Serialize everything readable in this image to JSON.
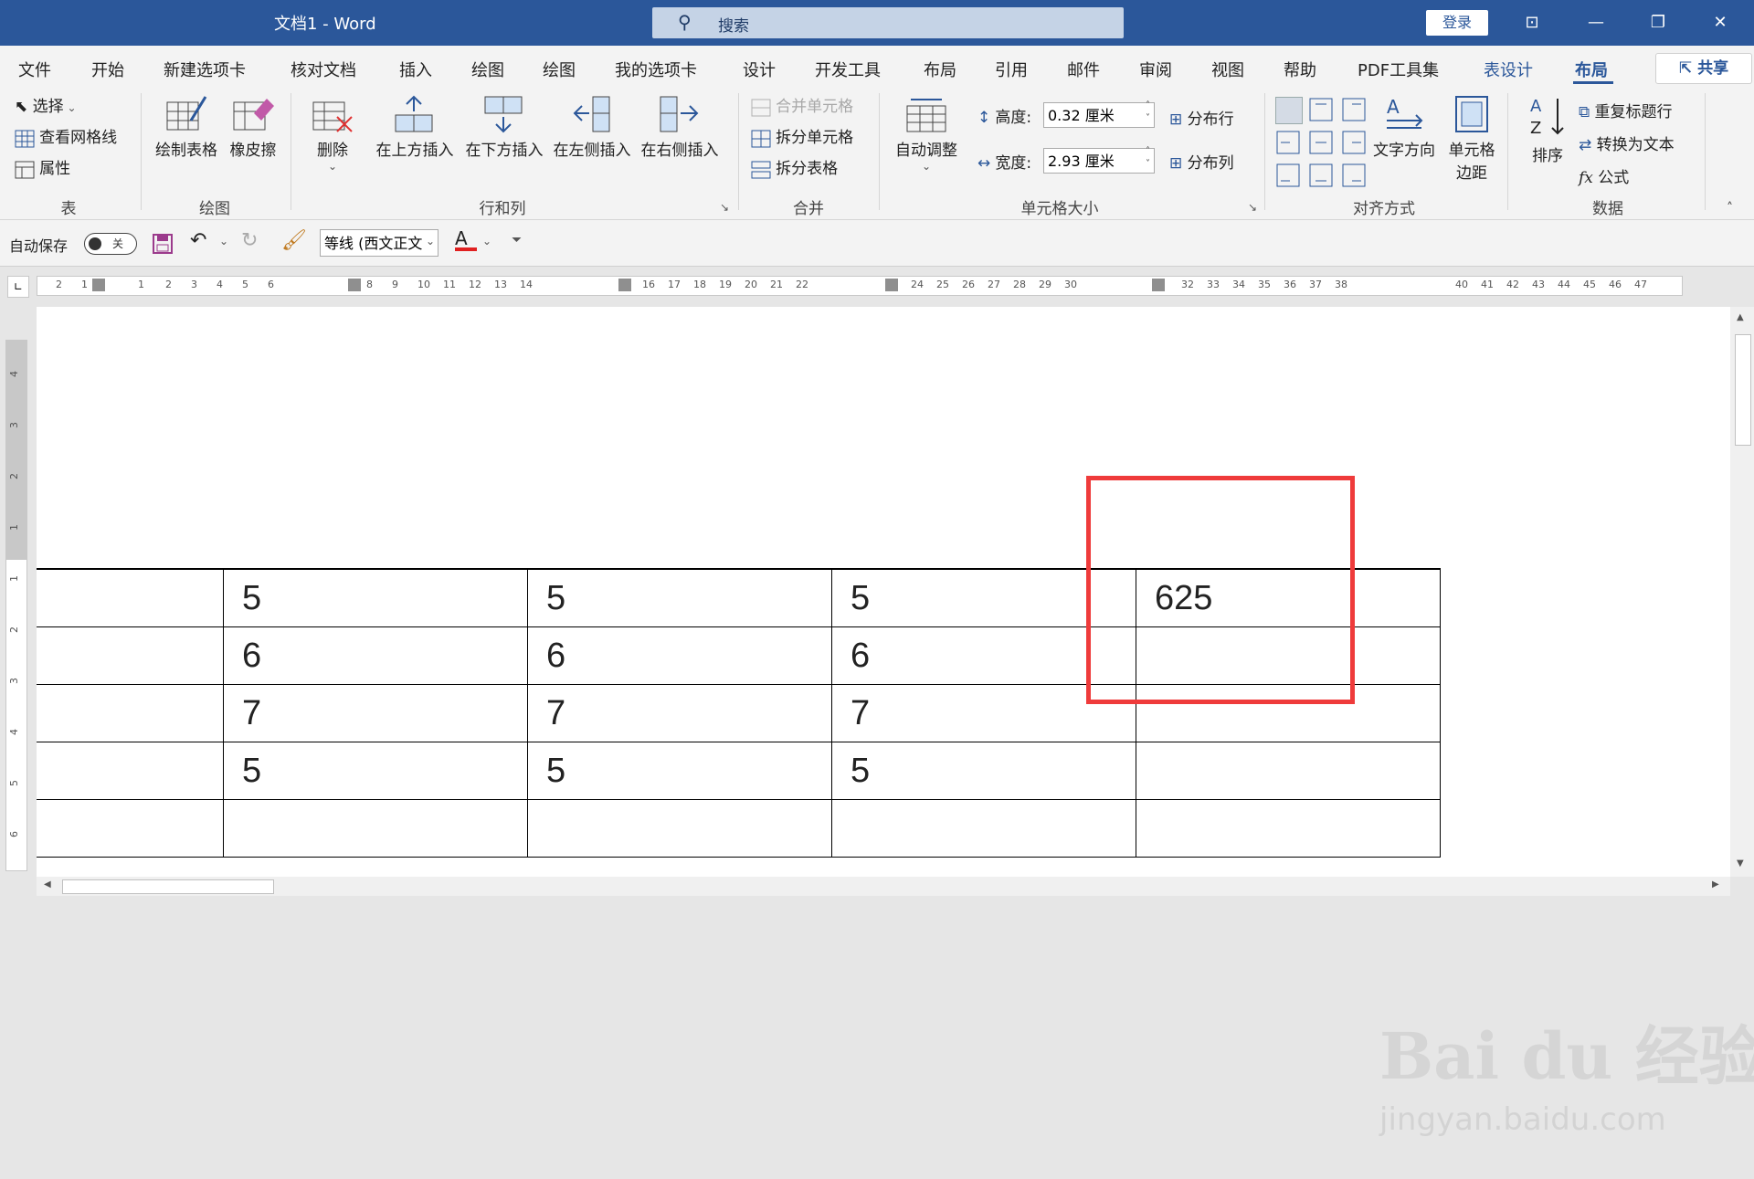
{
  "titlebar": {
    "doc_title": "文档1  -  Word",
    "search_label": "搜索",
    "login_label": "登录",
    "ribbon_display_icon": "ribbon-display-icon",
    "minimize_icon": "minimize-icon",
    "restore_icon": "restore-icon",
    "close_icon": "close-icon"
  },
  "tabs": [
    "文件",
    "开始",
    "新建选项卡",
    "核对文档",
    "插入",
    "绘图",
    "绘图",
    "我的选项卡",
    "设计",
    "开发工具",
    "布局",
    "引用",
    "邮件",
    "审阅",
    "视图",
    "帮助",
    "PDF工具集",
    "表设计",
    "布局"
  ],
  "share_label": "共享",
  "ribbon": {
    "table_group": {
      "label": "表",
      "select": "选择",
      "gridlines": "查看网格线",
      "properties": "属性"
    },
    "draw_group": {
      "label": "绘图",
      "draw_table": "绘制表格",
      "eraser": "橡皮擦"
    },
    "rowcol_group": {
      "label": "行和列",
      "delete": "删除",
      "insert_above": "在上方插入",
      "insert_below": "在下方插入",
      "insert_left": "在左侧插入",
      "insert_right": "在右侧插入"
    },
    "merge_group": {
      "label": "合并",
      "merge_cells": "合并单元格",
      "split_cells": "拆分单元格",
      "split_table": "拆分表格"
    },
    "cellsize_group": {
      "label": "单元格大小",
      "autofit": "自动调整",
      "height_label": "高度:",
      "height_value": "0.32 厘米",
      "width_label": "宽度:",
      "width_value": "2.93 厘米",
      "distribute_rows": "分布行",
      "distribute_cols": "分布列"
    },
    "align_group": {
      "label": "对齐方式",
      "text_direction": "文字方向",
      "cell_margins_1": "单元格",
      "cell_margins_2": "边距"
    },
    "data_group": {
      "label": "数据",
      "sort": "排序",
      "repeat_header": "重复标题行",
      "convert_text": "转换为文本",
      "formula": "公式"
    }
  },
  "qat": {
    "autosave_label": "自动保存",
    "toggle_label": "关",
    "font_name": "等线 (西文正文"
  },
  "ruler": {
    "h_numbers": [
      "2",
      "1",
      "1",
      "2",
      "3",
      "4",
      "5",
      "6",
      "8",
      "9",
      "10",
      "11",
      "12",
      "13",
      "14",
      "16",
      "17",
      "18",
      "19",
      "20",
      "21",
      "22",
      "24",
      "25",
      "26",
      "27",
      "28",
      "29",
      "30",
      "32",
      "33",
      "34",
      "35",
      "36",
      "37",
      "38",
      "40",
      "41",
      "42",
      "43",
      "44",
      "45",
      "46",
      "47"
    ],
    "v_numbers": [
      "4",
      "3",
      "2",
      "1",
      "1",
      "2",
      "3",
      "4",
      "5",
      "6"
    ]
  },
  "table": {
    "rows": [
      [
        "",
        "5",
        "5",
        "5",
        "625"
      ],
      [
        "",
        "6",
        "6",
        "6",
        ""
      ],
      [
        "",
        "7",
        "7",
        "7",
        ""
      ],
      [
        "",
        "5",
        "5",
        "5",
        ""
      ],
      [
        "",
        "",
        "",
        "",
        ""
      ]
    ]
  },
  "watermark": {
    "line1": "Bai du 经验",
    "line2": "jingyan.baidu.com"
  },
  "colors": {
    "accent": "#2b579a",
    "highlight": "#ef3b3b"
  }
}
